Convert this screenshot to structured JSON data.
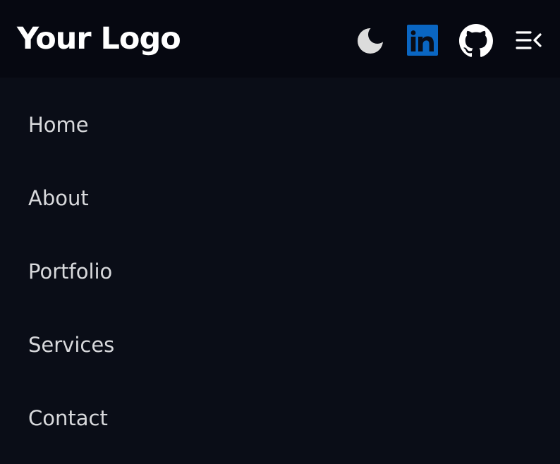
{
  "header": {
    "logo_text": "Your Logo",
    "icons": {
      "theme_toggle": "moon-icon",
      "linkedin": "linkedin-icon",
      "github": "github-icon",
      "menu": "menu-collapse-icon"
    }
  },
  "nav": {
    "items": [
      {
        "label": "Home"
      },
      {
        "label": "About"
      },
      {
        "label": "Portfolio"
      },
      {
        "label": "Services"
      },
      {
        "label": "Contact"
      }
    ]
  },
  "colors": {
    "background": "#0a0d17",
    "header_background": "#060811",
    "text": "#d8d9dc",
    "logo": "#ffffff",
    "linkedin_brand": "#0a66c2"
  }
}
